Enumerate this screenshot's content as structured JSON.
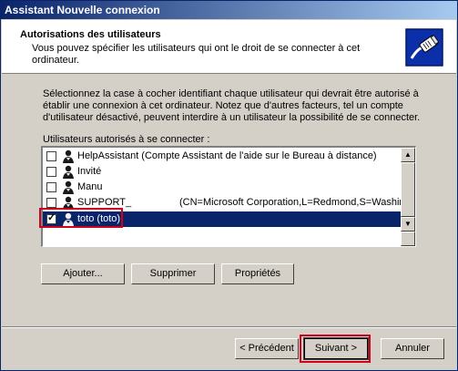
{
  "window": {
    "title": "Assistant Nouvelle connexion"
  },
  "header": {
    "title": "Autorisations des utilisateurs",
    "subtitle": "Vous pouvez spécifier les utilisateurs qui ont le droit de se connecter à cet ordinateur.",
    "icon": "network-cable-icon"
  },
  "description": "Sélectionnez la case à cocher identifiant chaque utilisateur qui devrait être autorisé à établir une connexion à cet ordinateur. Notez que d'autres facteurs, tel un compte d'utilisateur désactivé, peuvent interdire à un utilisateur la possibilité de se connecter.",
  "list": {
    "label": "Utilisateurs autorisés à se connecter :",
    "items": [
      {
        "label": "HelpAssistant (Compte Assistant de l'aide sur le Bureau à distance)",
        "extra": "",
        "checked": false,
        "selected": false
      },
      {
        "label": "Invité",
        "extra": "",
        "checked": false,
        "selected": false
      },
      {
        "label": "Manu",
        "extra": "",
        "checked": false,
        "selected": false
      },
      {
        "label": "SUPPORT_",
        "extra": "(CN=Microsoft Corporation,L=Redmond,S=Washingto",
        "checked": false,
        "selected": false
      },
      {
        "label": "toto (toto)",
        "extra": "",
        "checked": true,
        "selected": true
      }
    ]
  },
  "buttons": {
    "add": "Ajouter...",
    "remove": "Supprimer",
    "properties": "Propriétés",
    "back": "< Précédent",
    "next": "Suivant >",
    "cancel": "Annuler"
  },
  "colors": {
    "title_start": "#0a246a",
    "title_end": "#a6caf0",
    "selection": "#0a246a",
    "highlight": "#d0021b"
  }
}
